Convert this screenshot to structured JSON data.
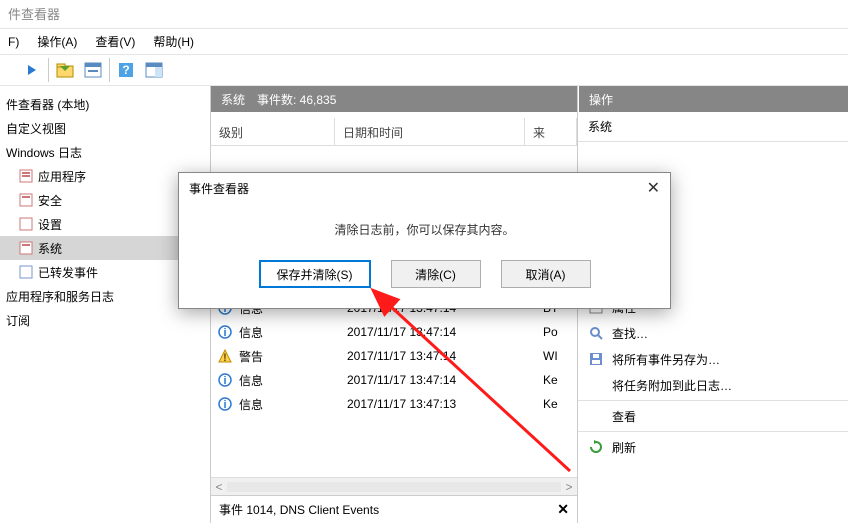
{
  "window": {
    "title": "件查看器"
  },
  "menu": {
    "file": "F)",
    "action": "操作(A)",
    "view": "查看(V)",
    "help": "帮助(H)"
  },
  "tree": {
    "root": "件查看器 (本地)",
    "item_custom": "自定义视图",
    "item_winlogs": "Windows 日志",
    "item_app": "应用程序",
    "item_sec": "安全",
    "item_setup": "设置",
    "item_system": "系统",
    "item_forward": "已转发事件",
    "item_appsvc": "应用程序和服务日志",
    "item_sub": "订阅"
  },
  "center": {
    "title": "系统",
    "count_label": "事件数: 46,835",
    "col_level": "级别",
    "col_date": "日期和时间",
    "col_src": "来",
    "rows": [
      {
        "level": "信息",
        "icon": "info",
        "date": "2017/11/17 13:47:14",
        "src": "BT"
      },
      {
        "level": "信息",
        "icon": "info",
        "date": "2017/11/17 13:47:14",
        "src": "Po"
      },
      {
        "level": "警告",
        "icon": "warn",
        "date": "2017/11/17 13:47:14",
        "src": "WI"
      },
      {
        "level": "信息",
        "icon": "info",
        "date": "2017/11/17 13:47:14",
        "src": "Ke"
      },
      {
        "level": "信息",
        "icon": "info",
        "date": "2017/11/17 13:47:13",
        "src": "Ke"
      }
    ],
    "detail": "事件 1014, DNS Client Events"
  },
  "actions": {
    "header": "操作",
    "subheader": "系统",
    "properties": "属性",
    "find": "查找…",
    "saveall": "将所有事件另存为…",
    "attach": "将任务附加到此日志…",
    "view": "查看",
    "refresh": "刷新"
  },
  "dialog": {
    "title": "事件查看器",
    "message": "清除日志前，你可以保存其内容。",
    "btn_save": "保存并清除(S)",
    "btn_clear": "清除(C)",
    "btn_cancel": "取消(A)"
  }
}
